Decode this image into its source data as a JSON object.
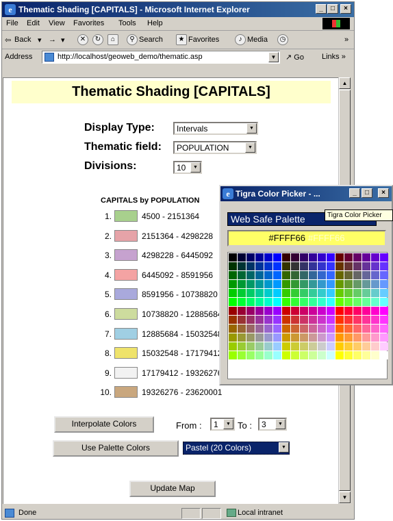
{
  "window": {
    "title": "Thematic Shading [CAPITALS] - Microsoft Internet Explorer",
    "controls": [
      "_",
      "□",
      "×"
    ]
  },
  "menu": [
    "File",
    "Edit",
    "View",
    "Favorites",
    "Tools",
    "Help"
  ],
  "toolbar": {
    "back": "Back",
    "forward": "→",
    "search": "Search",
    "favorites": "Favorites",
    "media": "Media",
    "more": "»"
  },
  "address": {
    "label": "Address",
    "url": "http://localhost/geoweb_demo/thematic.asp",
    "go": "Go",
    "links": "Links"
  },
  "page": {
    "title": "Thematic Shading [CAPITALS]",
    "display_type_label": "Display Type:",
    "display_type_value": "Intervals",
    "field_label": "Thematic field:",
    "field_value": "POPULATION",
    "divisions_label": "Divisions:",
    "divisions_value": "10",
    "legend_title": "CAPITALS by POPULATION",
    "legend": [
      {
        "num": "1.",
        "range": "4500           - 2151364",
        "color": "#a8d08d"
      },
      {
        "num": "2.",
        "range": "2151364  - 4298228",
        "color": "#e6a3a8"
      },
      {
        "num": "3.",
        "range": "4298228  - 6445092",
        "color": "#c6a2cf"
      },
      {
        "num": "4.",
        "range": "6445092  - 8591956",
        "color": "#f4a3a3"
      },
      {
        "num": "5.",
        "range": "8591956  - 10738820",
        "color": "#a9a9dc"
      },
      {
        "num": "6.",
        "range": "10738820 - 12885684",
        "color": "#cddc9e"
      },
      {
        "num": "7.",
        "range": "12885684 - 15032548",
        "color": "#a0cfe3"
      },
      {
        "num": "8.",
        "range": "15032548 - 17179412",
        "color": "#efe36b"
      },
      {
        "num": "9.",
        "range": "17179412 - 19326276",
        "color": "#f2f2f2"
      },
      {
        "num": "10.",
        "range": "19326276 - 23620001",
        "color": "#c9a77e"
      }
    ],
    "interpolate_button": "Interpolate Colors",
    "from_label": "From :",
    "from_value": "1",
    "to_label": "To :",
    "to_value": "3",
    "palette_button": "Use Palette Colors",
    "palette_value": "Pastel (20 Colors)",
    "update_button": "Update Map"
  },
  "status": {
    "text": "Done",
    "zone": "Local intranet"
  },
  "picker": {
    "title": "Tigra Color Picker - ...",
    "palette": "Web Safe Palette",
    "tooltip": "Tigra Color Picker",
    "value": "#FFFF66",
    "ghost_value": "#FFFF66"
  }
}
